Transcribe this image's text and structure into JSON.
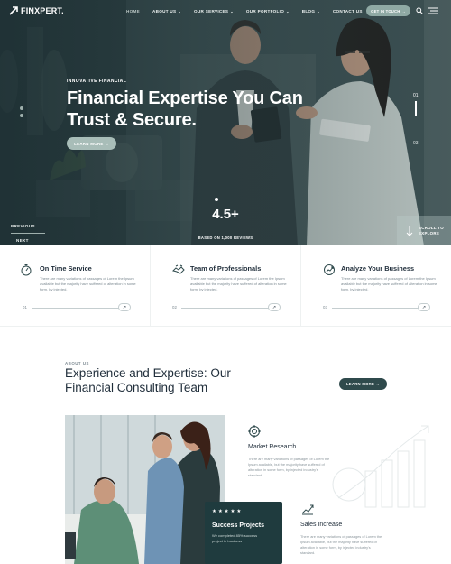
{
  "brand": {
    "name": "FINXPERT.",
    "accent": "#2f4a4c",
    "soft_accent": "#8fa9a4"
  },
  "nav": {
    "items": [
      {
        "label": "HOME",
        "active": true,
        "dropdown": false
      },
      {
        "label": "ABOUT US",
        "active": false,
        "dropdown": true
      },
      {
        "label": "OUR SERVICES",
        "active": false,
        "dropdown": true
      },
      {
        "label": "OUR PORTFOLIO",
        "active": false,
        "dropdown": true
      },
      {
        "label": "BLOG",
        "active": false,
        "dropdown": true
      },
      {
        "label": "CONTACT US",
        "active": false,
        "dropdown": false
      }
    ],
    "cta": "GET IN TOUCH"
  },
  "hero": {
    "eyebrow": "INNOVATIVE FINANCIAL",
    "title": "Financial Expertise You Can Trust & Secure.",
    "button": "LEARN MORE →",
    "slide_current": "01",
    "slide_last": "03",
    "rating_value": "4.5+",
    "rating_caption": "BASED ON 1,000 REVIEWS",
    "prev": "PREVIOUS",
    "next": "NEXT",
    "scroll_label_1": "SCROLL TO",
    "scroll_label_2": "EXPLORE"
  },
  "features": [
    {
      "title": "On Time Service",
      "text": "There are many variations of passages of Lorem the Ipsum available but the majority have suffered of alteration in some form, by injected.",
      "num": "01"
    },
    {
      "title": "Team of Professionals",
      "text": "There are many variations of passages of Lorem the Ipsum available but the majority have suffered of alteration in some form, by injected.",
      "num": "02"
    },
    {
      "title": "Analyze Your Business",
      "text": "There are many variations of passages of Lorem the Ipsum available but the majority have suffered of alteration in some form, by injected.",
      "num": "03"
    }
  ],
  "about": {
    "eyebrow": "ABOUT US",
    "title": "Experience and Expertise: Our Financial Consulting Team",
    "button": "LEARN MORE →",
    "card": {
      "stars": "★★★★★",
      "title": "Success Projects",
      "text": "We completed 85% success project in business"
    },
    "services": [
      {
        "title": "Market Research",
        "text": "There are many variations of passages of Lorem the Ipsum available, but the majority have suffered of alteration in some form, by injected industry's standard."
      },
      {
        "title": "Sales Increase",
        "text": "There are many variations of passages of Lorem the Ipsum available, but the majority have suffered of alteration in some form, by injected industry's standard."
      }
    ]
  }
}
